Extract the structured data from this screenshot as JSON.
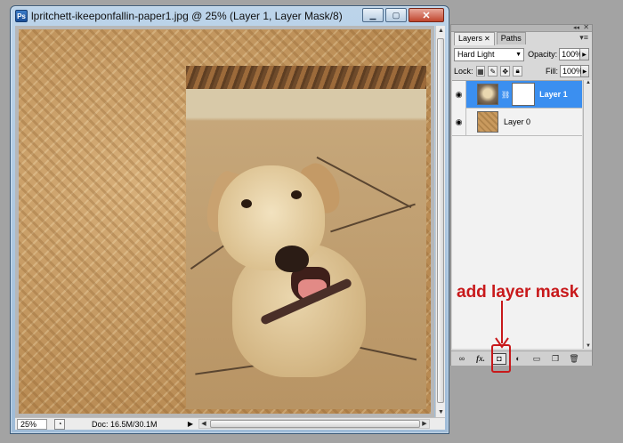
{
  "document_window": {
    "title": "lpritchett-ikeeponfallin-paper1.jpg @ 25% (Layer 1, Layer Mask/8)",
    "icon": "photoshop-doc-icon",
    "buttons": {
      "minimize": "minimize-icon",
      "maximize": "maximize-icon",
      "close": "close-icon"
    }
  },
  "status_bar": {
    "zoom": "25%",
    "doc_size": "Doc: 16.5M/30.1M"
  },
  "layers_panel": {
    "tabs": [
      {
        "label": "Layers",
        "active": true
      },
      {
        "label": "Paths",
        "active": false
      }
    ],
    "blend_mode": "Hard Light",
    "opacity_label": "Opacity:",
    "opacity_value": "100%",
    "lock_label": "Lock:",
    "fill_label": "Fill:",
    "fill_value": "100%",
    "layers": [
      {
        "name": "Layer 1",
        "selected": true,
        "has_mask": true,
        "visible": true
      },
      {
        "name": "Layer 0",
        "selected": false,
        "has_mask": false,
        "visible": true
      }
    ],
    "bottom_buttons": [
      "link-layers-icon",
      "fx-icon",
      "add-layer-mask-icon",
      "adjustment-layer-icon",
      "new-group-icon",
      "new-layer-icon",
      "trash-icon"
    ],
    "colors": {
      "selection": "#3b8ff0",
      "panel_bg": "#d8d8d8"
    }
  },
  "annotation": {
    "text": "add layer mask",
    "color": "#c8191b"
  }
}
